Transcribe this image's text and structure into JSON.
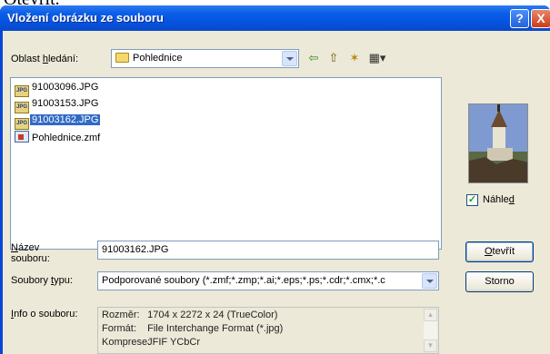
{
  "background_text": "Otevrit.",
  "titlebar": {
    "title": "Vložení obrázku ze souboru",
    "help": "?",
    "close": "X"
  },
  "lookin": {
    "label_pre": "Oblast ",
    "label_u": "h",
    "label_post": "ledání:",
    "value": "Pohlednice"
  },
  "toolbar": {
    "back": "⇦",
    "up": "⇧",
    "newfolder": "✶",
    "views": "▦▾"
  },
  "files": [
    {
      "name": "91003096.JPG",
      "type": "jpg",
      "selected": false
    },
    {
      "name": "91003153.JPG",
      "type": "jpg",
      "selected": false
    },
    {
      "name": "91003162.JPG",
      "type": "jpg",
      "selected": true
    },
    {
      "name": "Pohlednice.zmf",
      "type": "zmf",
      "selected": false
    }
  ],
  "jpg_badge": "JPG",
  "preview": {
    "label_pre": "Náhle",
    "label_u": "d",
    "checked_mark": "✓",
    "checked": true
  },
  "filename": {
    "label_u": "N",
    "label_line1": "ázev",
    "label_line2": "souboru:",
    "value": "91003162.JPG"
  },
  "filetype": {
    "label_pre": "Soubory ",
    "label_u": "t",
    "label_post": "ypu:",
    "value": "Podporované soubory (*.zmf;*.zmp;*.ai;*.eps;*.ps;*.cdr;*.cmx;*.c"
  },
  "buttons": {
    "open_u": "O",
    "open_rest": "tevřít",
    "cancel": "Storno"
  },
  "info": {
    "label_u": "I",
    "label_rest": "nfo o souboru:",
    "rows": [
      {
        "k": "Rozměr:",
        "v": "1704 x 2272 x 24 (TrueColor)"
      },
      {
        "k": "Formát:",
        "v": "File Interchange Format (*.jpg)"
      },
      {
        "k": "Komprese:",
        "v": "JFIF YCbCr"
      }
    ],
    "scroll_up": "▲",
    "scroll_down": "▼"
  }
}
